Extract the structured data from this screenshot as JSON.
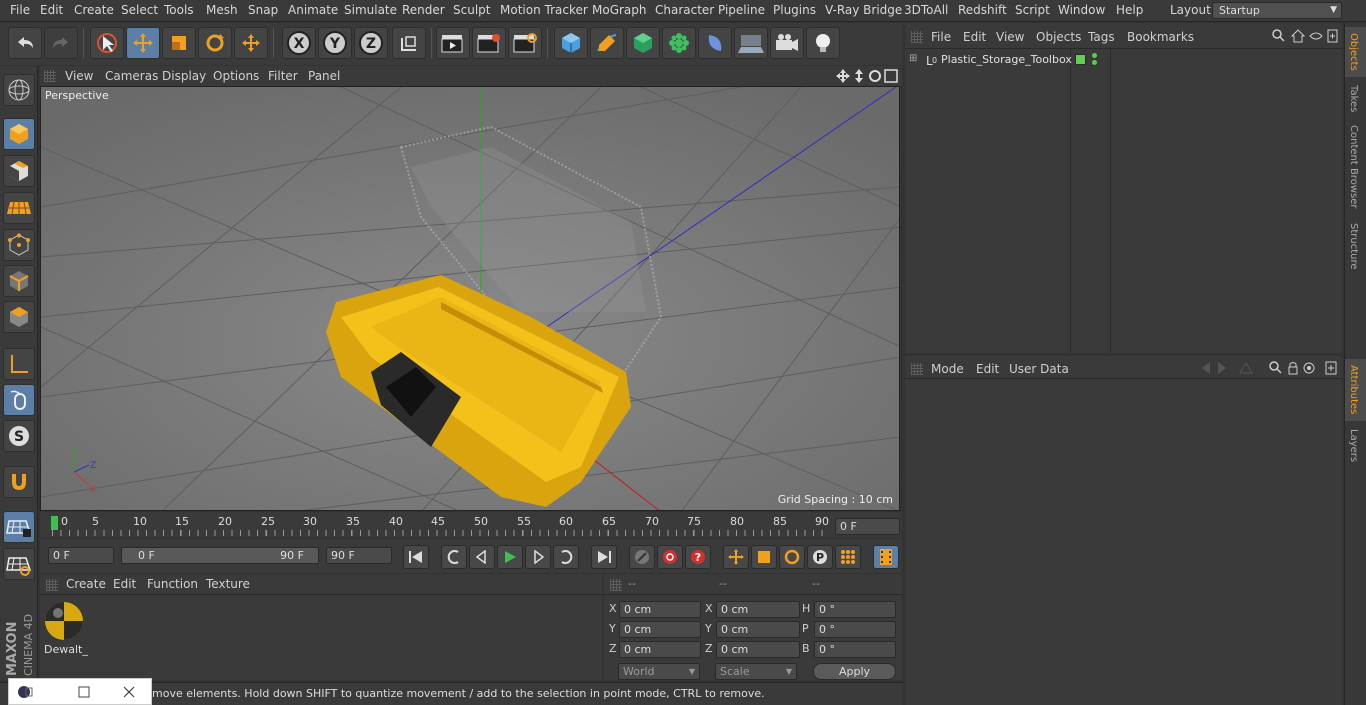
{
  "menu": [
    "File",
    "Edit",
    "Create",
    "Select",
    "Tools",
    "Mesh",
    "Snap",
    "Animate",
    "Simulate",
    "Render",
    "Sculpt",
    "Motion Tracker",
    "MoGraph",
    "Character",
    "Pipeline",
    "Plugins",
    "V-Ray Bridge",
    "3DToAll",
    "Redshift",
    "Script",
    "Window",
    "Help"
  ],
  "layout": {
    "label": "Layout:",
    "value": "Startup"
  },
  "viewport": {
    "menu": [
      "View",
      "Cameras",
      "Display",
      "Options",
      "Filter",
      "Panel"
    ],
    "camera": "Perspective",
    "grid_spacing": "Grid Spacing : 10 cm"
  },
  "timeline": {
    "ticks": [
      "0",
      "5",
      "10",
      "15",
      "20",
      "25",
      "30",
      "35",
      "40",
      "45",
      "50",
      "55",
      "60",
      "65",
      "70",
      "75",
      "80",
      "85",
      "90"
    ],
    "current_frame": "0 F"
  },
  "transport": {
    "start": "0 F",
    "range_start": "0 F",
    "range_end": "90 F",
    "end": "90 F"
  },
  "material_manager": {
    "menu": [
      "Create",
      "Edit",
      "Function",
      "Texture"
    ],
    "material_name": "Dewalt_"
  },
  "coordinates": {
    "headers": [
      "--",
      "--",
      "--"
    ],
    "rows": [
      {
        "a": "X",
        "av": "0 cm",
        "b": "X",
        "bv": "0 cm",
        "c": "H",
        "cv": "0 °"
      },
      {
        "a": "Y",
        "av": "0 cm",
        "b": "Y",
        "bv": "0 cm",
        "c": "P",
        "cv": "0 °"
      },
      {
        "a": "Z",
        "av": "0 cm",
        "b": "Z",
        "bv": "0 cm",
        "c": "B",
        "cv": "0 °"
      }
    ],
    "mode": "World",
    "size_mode": "Scale",
    "apply": "Apply"
  },
  "status_text": "move elements. Hold down SHIFT to quantize movement / add to the selection in point mode, CTRL to remove.",
  "object_manager": {
    "menu": [
      "File",
      "Edit",
      "View",
      "Objects",
      "Tags",
      "Bookmarks"
    ],
    "object": "Plastic_Storage_Toolbox"
  },
  "attribute_manager": {
    "menu": [
      "Mode",
      "Edit",
      "User Data"
    ]
  },
  "side_tabs": [
    "Objects",
    "Takes",
    "Content Browser",
    "Structure",
    "Attributes",
    "Layers"
  ],
  "brand": {
    "maxon": "MAXON",
    "product": "CINEMA 4D"
  },
  "colors": {
    "accent": "#5c7fa8",
    "toolbox": "#f0c020",
    "bg": "#3a3a3a"
  }
}
